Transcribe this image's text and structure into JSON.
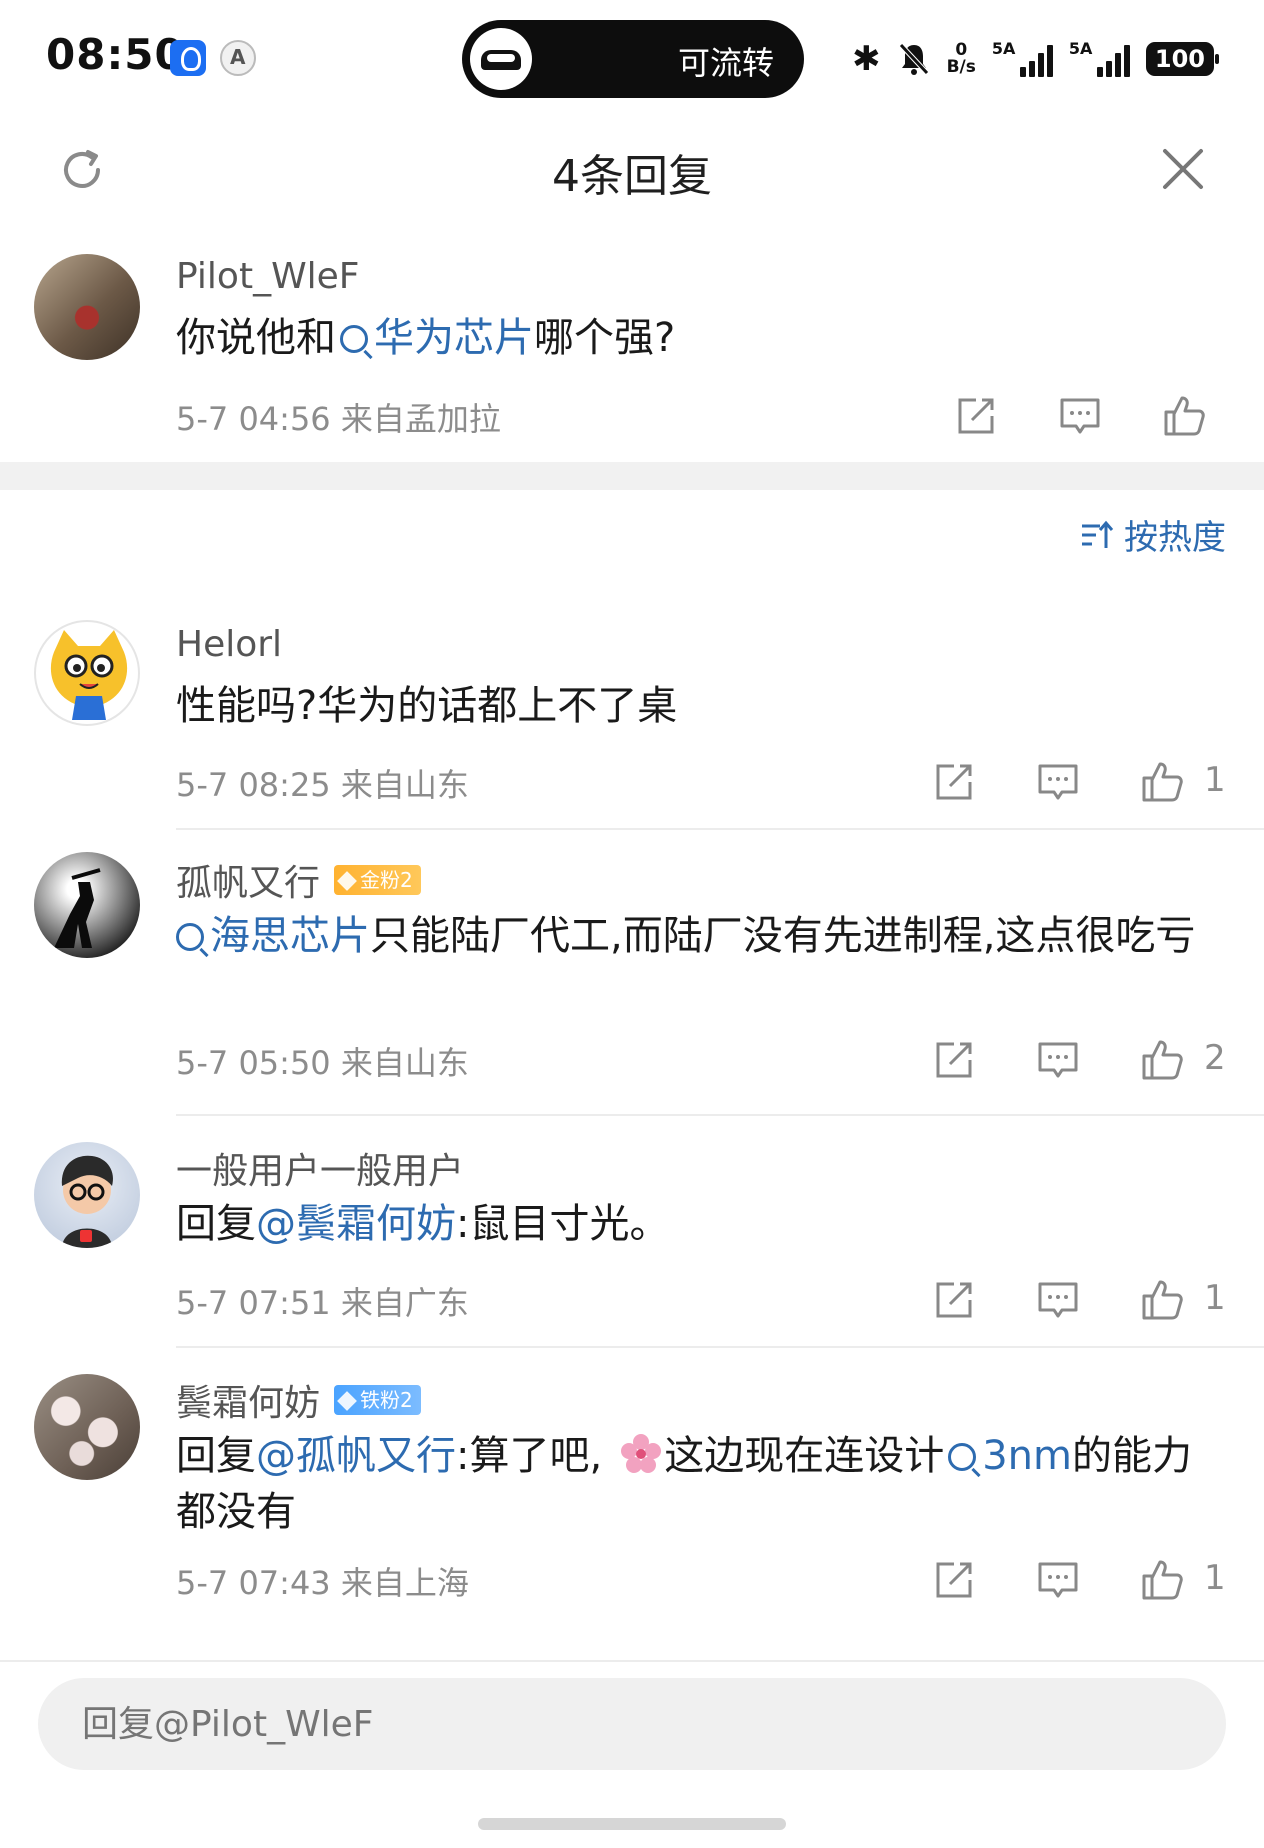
{
  "status_bar": {
    "time": "08:50",
    "island_text": "可流转",
    "net_speed_value": "0",
    "net_speed_unit": "B/s",
    "signal1_label": "5A",
    "signal2_label": "5A",
    "battery": "100"
  },
  "header": {
    "title": "4条回复"
  },
  "root_comment": {
    "user": "Pilot_WleF",
    "text_before": "你说他和",
    "topic": "华为芯片",
    "text_after": "哪个强?",
    "meta": "5-7 04:56 来自孟加拉"
  },
  "sort": {
    "label": "按热度"
  },
  "replies": [
    {
      "user": "Helorl",
      "text": "性能吗?华为的话都上不了桌",
      "meta": "5-7 08:25 来自山东",
      "likes": "1"
    },
    {
      "user": "孤帆又行",
      "badge": "金粉2",
      "topic": "海思芯片",
      "text_after": "只能陆厂代工,而陆厂没有先进制程,这点很吃亏",
      "meta": "5-7 05:50 来自山东",
      "likes": "2"
    },
    {
      "user": "一般用户一般用户",
      "prefix": "回复",
      "mention": "@鬓霜何妨",
      "text_after": ":鼠目寸光。",
      "meta": "5-7 07:51 来自广东",
      "likes": "1"
    },
    {
      "user": "鬓霜何妨",
      "badge": "铁粉2",
      "prefix": "回复",
      "mention": "@孤帆又行",
      "text_mid": ":算了吧,",
      "text_mid2": "这边现在连设计",
      "topic": "3nm",
      "text_after": "的能力都没有",
      "meta": "5-7 07:43 来自上海",
      "likes": "1"
    }
  ],
  "reply_input": {
    "placeholder": "回复@Pilot_WleF"
  },
  "colors": {
    "link": "#2d6bb0",
    "meta": "#8c8c8c",
    "badge_gold": "#ffb230",
    "badge_iron": "#4aa3ff"
  }
}
